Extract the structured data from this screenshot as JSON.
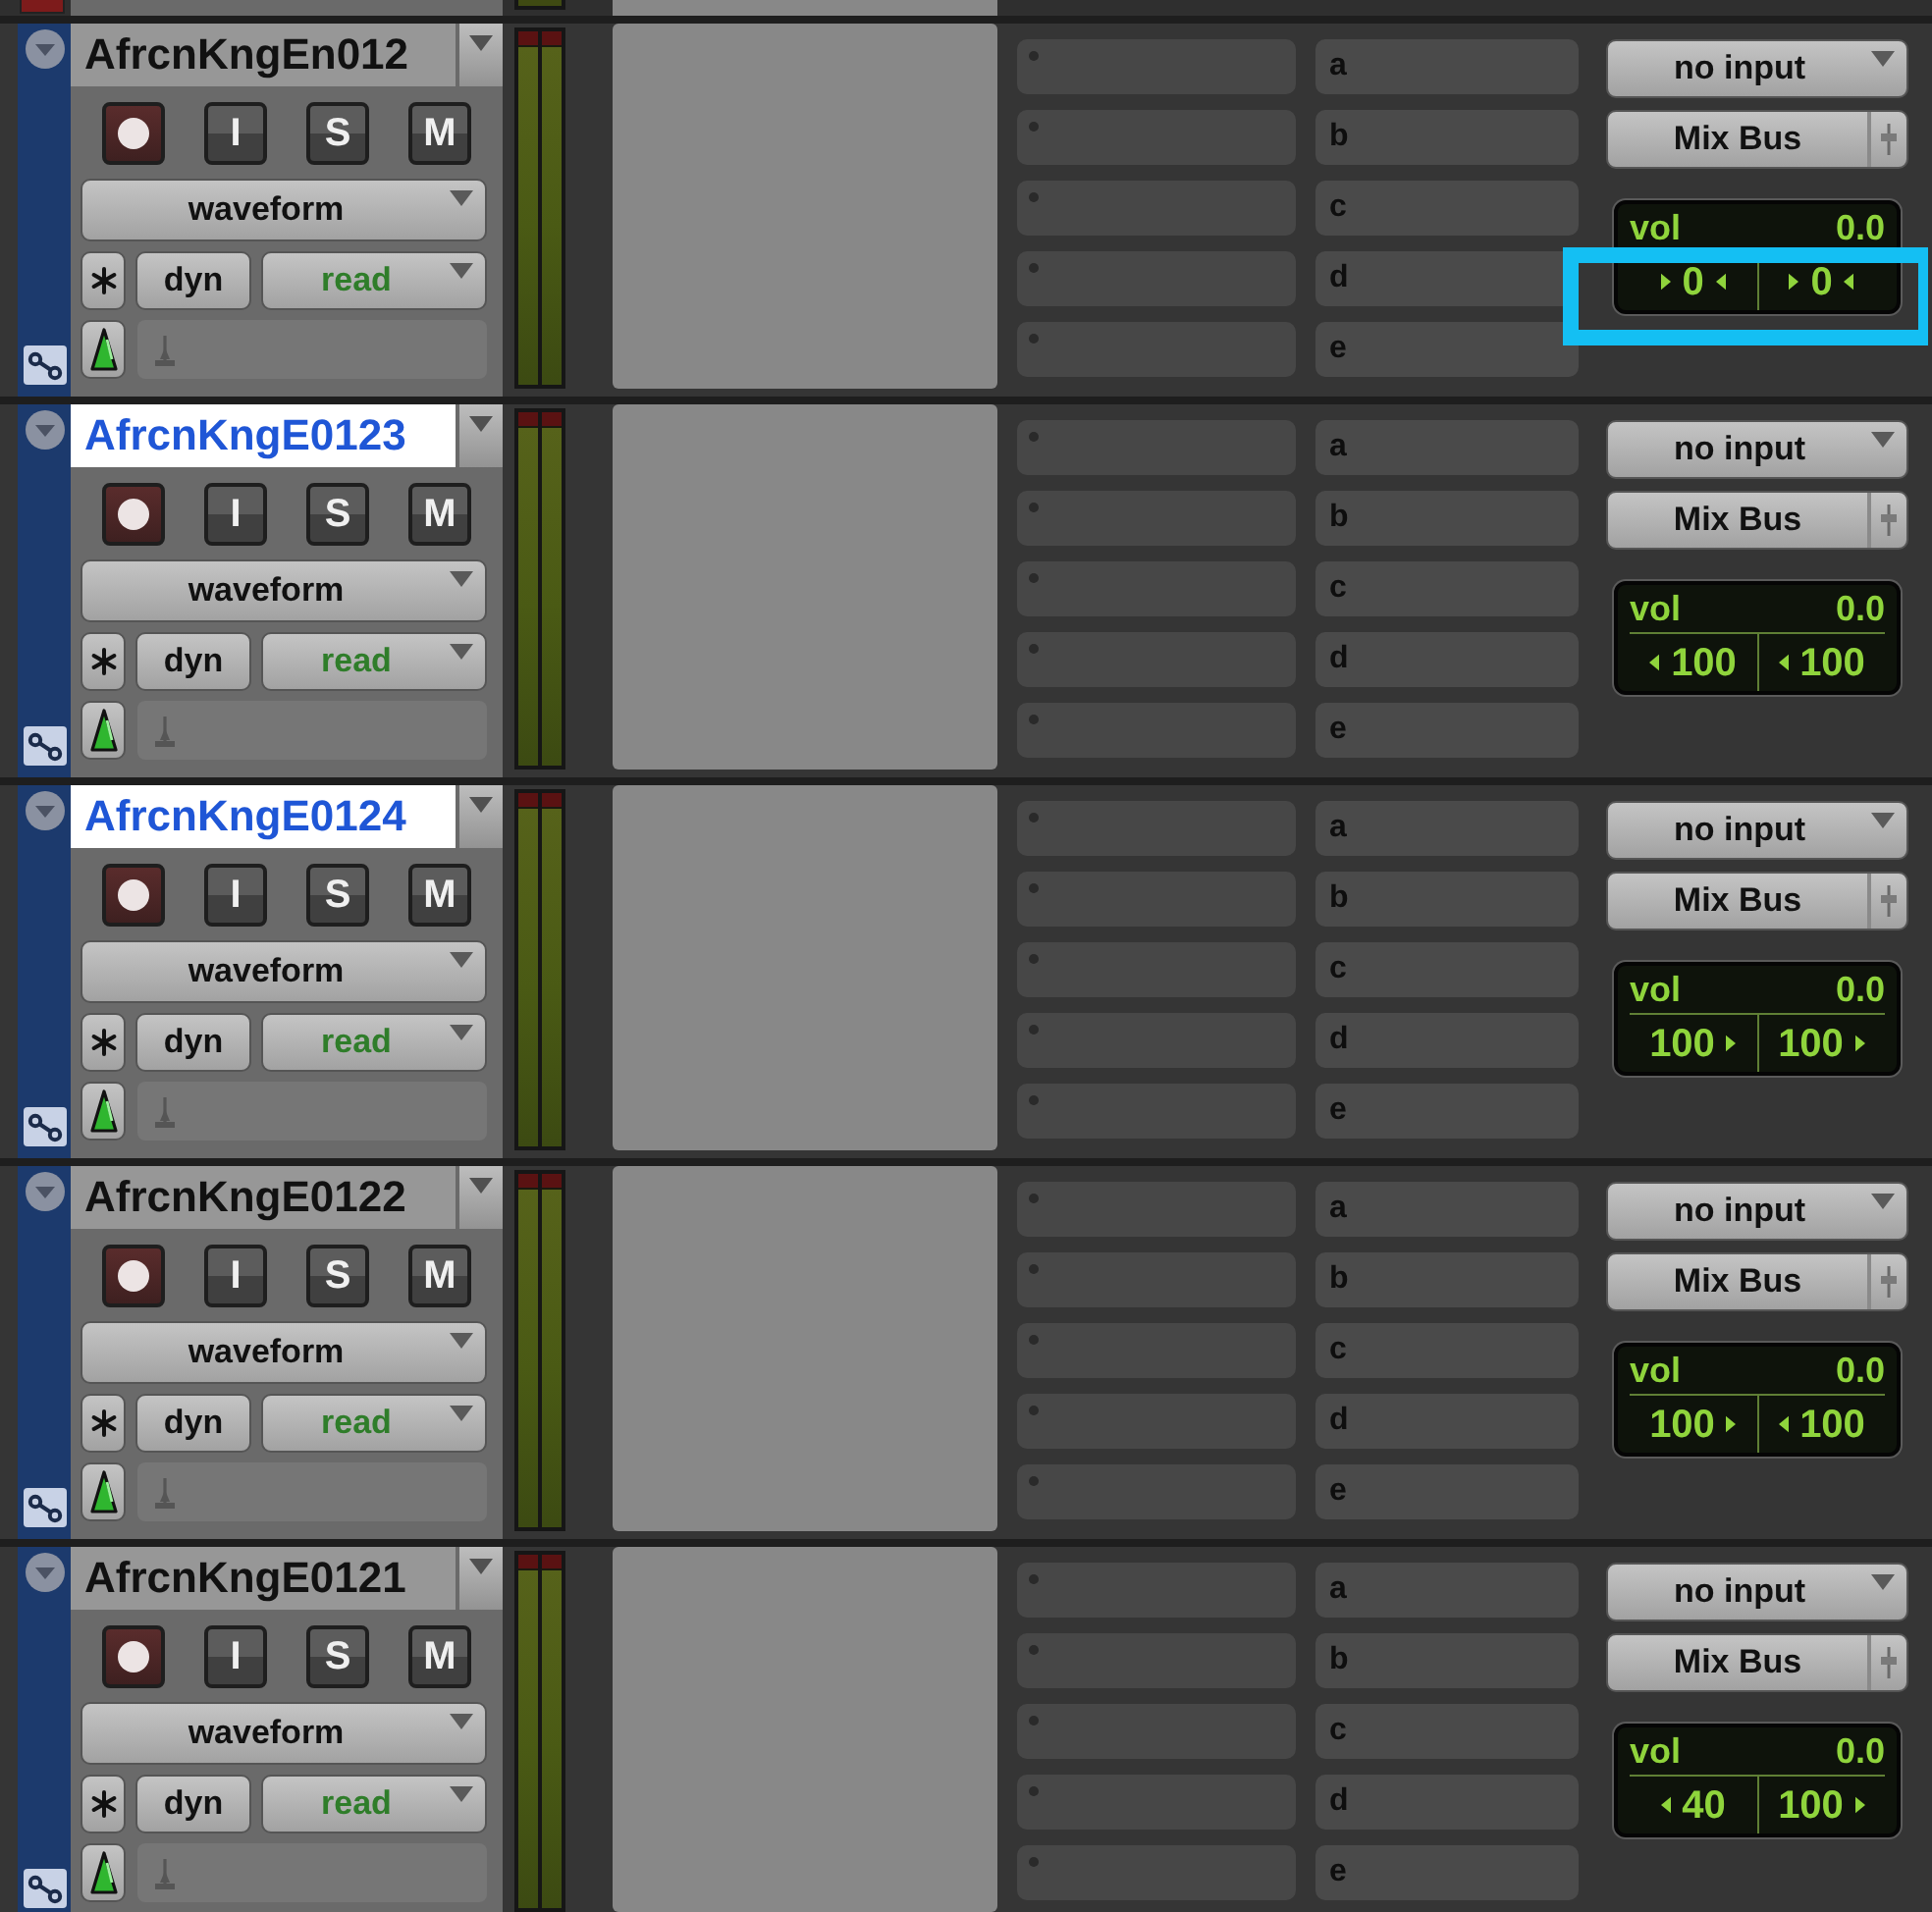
{
  "tracks": [
    {
      "name": "AfrcnKngEn012",
      "selected": false,
      "mode_buttons": [
        "I",
        "S",
        "M"
      ],
      "view": "waveform",
      "dyn": "dyn",
      "automation": "read",
      "sends": [
        "a",
        "b",
        "c",
        "d",
        "e"
      ],
      "input": "no input",
      "output": "Mix Bus",
      "volume_label": "vol",
      "volume": "0.0",
      "pan": [
        {
          "kind": "center",
          "value": "0"
        },
        {
          "kind": "center",
          "value": "0"
        }
      ],
      "highlighted": true
    },
    {
      "name": "AfrcnKngE0123",
      "selected": true,
      "mode_buttons": [
        "I",
        "S",
        "M"
      ],
      "view": "waveform",
      "dyn": "dyn",
      "automation": "read",
      "sends": [
        "a",
        "b",
        "c",
        "d",
        "e"
      ],
      "input": "no input",
      "output": "Mix Bus",
      "volume_label": "vol",
      "volume": "0.0",
      "pan": [
        {
          "kind": "left",
          "value": "100"
        },
        {
          "kind": "left",
          "value": "100"
        }
      ],
      "highlighted": false
    },
    {
      "name": "AfrcnKngE0124",
      "selected": true,
      "mode_buttons": [
        "I",
        "S",
        "M"
      ],
      "view": "waveform",
      "dyn": "dyn",
      "automation": "read",
      "sends": [
        "a",
        "b",
        "c",
        "d",
        "e"
      ],
      "input": "no input",
      "output": "Mix Bus",
      "volume_label": "vol",
      "volume": "0.0",
      "pan": [
        {
          "kind": "right",
          "value": "100"
        },
        {
          "kind": "right",
          "value": "100"
        }
      ],
      "highlighted": false
    },
    {
      "name": "AfrcnKngE0122",
      "selected": false,
      "mode_buttons": [
        "I",
        "S",
        "M"
      ],
      "view": "waveform",
      "dyn": "dyn",
      "automation": "read",
      "sends": [
        "a",
        "b",
        "c",
        "d",
        "e"
      ],
      "input": "no input",
      "output": "Mix Bus",
      "volume_label": "vol",
      "volume": "0.0",
      "pan": [
        {
          "kind": "right",
          "value": "100"
        },
        {
          "kind": "left",
          "value": "100"
        }
      ],
      "highlighted": false
    },
    {
      "name": "AfrcnKngE0121",
      "selected": false,
      "mode_buttons": [
        "I",
        "S",
        "M"
      ],
      "view": "waveform",
      "dyn": "dyn",
      "automation": "read",
      "sends": [
        "a",
        "b",
        "c",
        "d",
        "e"
      ],
      "input": "no input",
      "output": "Mix Bus",
      "volume_label": "vol",
      "volume": "0.0",
      "pan": [
        {
          "kind": "left",
          "value": "40"
        },
        {
          "kind": "right",
          "value": "100"
        }
      ],
      "highlighted": false
    }
  ]
}
